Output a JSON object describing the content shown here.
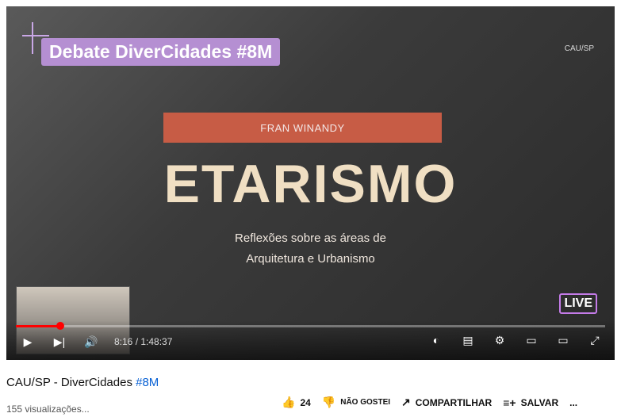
{
  "video": {
    "overlay_title": "Debate DiverCidades #8M",
    "logo": "CAU/SP",
    "speaker": "FRAN WINANDY",
    "main_title": "ETARISMO",
    "subtitle_line1": "Reflexões sobre as áreas de",
    "subtitle_line2": "Arquitetura e Urbanismo",
    "live_badge": "LIVE",
    "time": "8:16 / 1:48:37",
    "progress_fraction": 0.076
  },
  "below": {
    "title_prefix": "CAU/SP - DiverCidades ",
    "title_hashtag": "#8M",
    "views": "155 visualizações...",
    "likes": "24",
    "dislike_label": "NÃO GOSTEI",
    "share_label": "COMPARTILHAR",
    "save_label": "SALVAR",
    "more": "..."
  },
  "icons": {
    "play": "play-icon",
    "next": "next-icon",
    "volume": "volume-icon",
    "toggle": "autoplay-toggle-icon",
    "captions": "captions-icon",
    "settings": "gear-icon",
    "miniplayer": "miniplayer-icon",
    "theater": "theater-icon",
    "fullscreen": "fullscreen-icon"
  }
}
